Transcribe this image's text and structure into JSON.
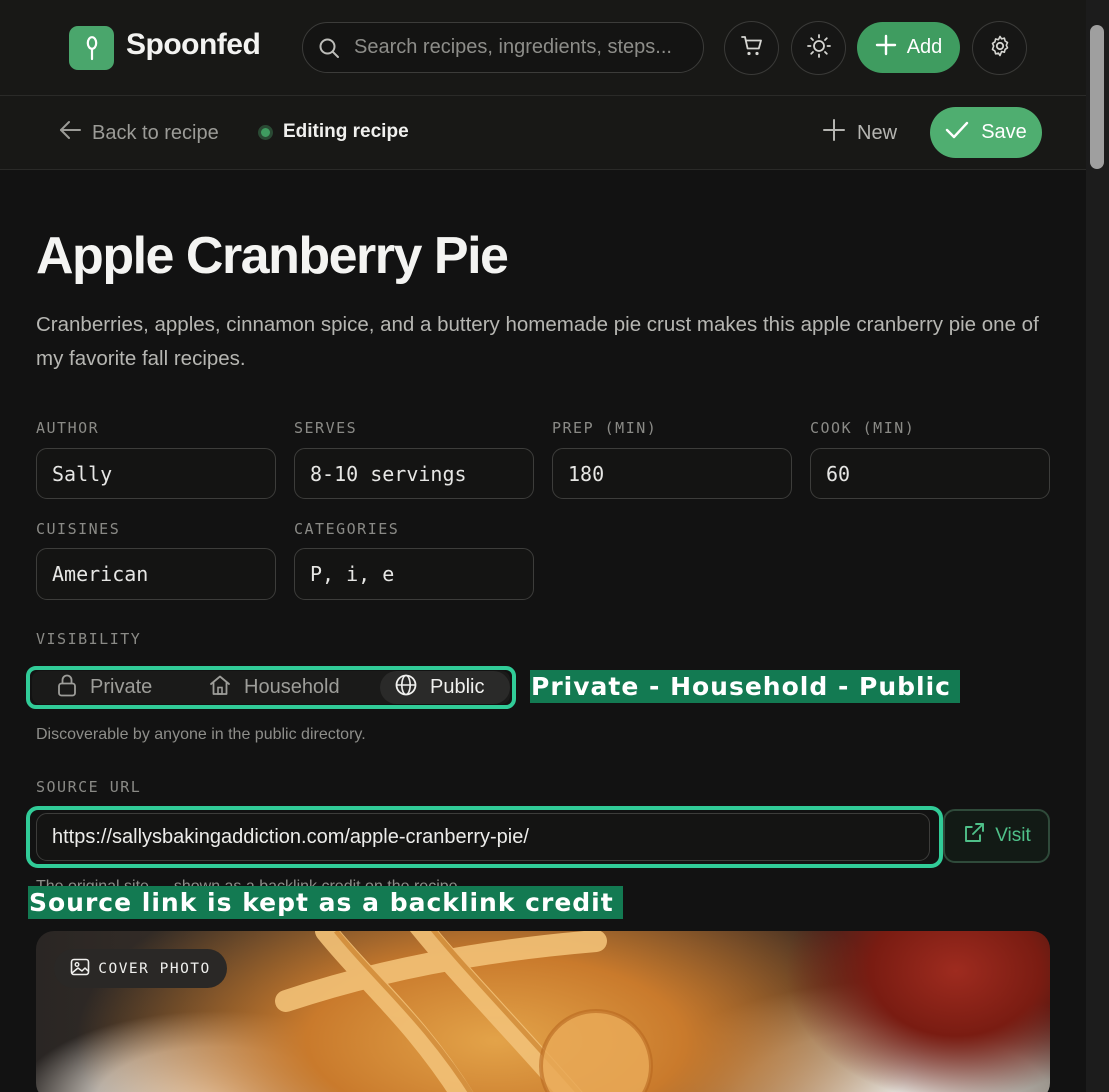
{
  "app": {
    "name": "Spoonfed"
  },
  "search": {
    "placeholder": "Search recipes, ingredients, steps..."
  },
  "header": {
    "add_label": "Add"
  },
  "subbar": {
    "back_label": "Back to recipe",
    "status_label": "Editing recipe",
    "new_label": "New",
    "save_label": "Save"
  },
  "recipe": {
    "title": "Apple Cranberry Pie",
    "description": "Cranberries, apples, cinnamon spice, and a buttery homemade pie crust makes this apple cranberry pie one of my favorite fall recipes."
  },
  "fields": {
    "author": {
      "label": "AUTHOR",
      "value": "Sally"
    },
    "serves": {
      "label": "SERVES",
      "value": "8-10 servings"
    },
    "prep": {
      "label": "PREP (MIN)",
      "value": "180"
    },
    "cook": {
      "label": "COOK (MIN)",
      "value": "60"
    },
    "cuisines": {
      "label": "CUISINES",
      "value": "American"
    },
    "categories": {
      "label": "CATEGORIES",
      "value": "P, i, e"
    }
  },
  "visibility": {
    "label": "VISIBILITY",
    "options": [
      "Private",
      "Household",
      "Public"
    ],
    "selected": "Public",
    "helper": "Discoverable by anyone in the public directory.",
    "annotation": "Private - Household - Public"
  },
  "source": {
    "label": "SOURCE URL",
    "value": "https://sallysbakingaddiction.com/apple-cranberry-pie/",
    "visit_label": "Visit",
    "helper": "The original site — shown as a backlink credit on the recipe.",
    "annotation": "Source link is kept as a backlink credit"
  },
  "cover": {
    "badge": "COVER PHOTO"
  },
  "colors": {
    "brand_green": "#3f9c60",
    "save_green": "#4fae70",
    "highlight_outline": "#31cc98",
    "annotation_bg": "#137a52",
    "background": "#121212"
  }
}
